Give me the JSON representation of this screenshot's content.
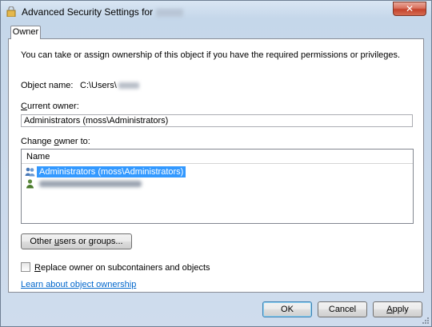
{
  "window": {
    "title": "Advanced Security Settings for",
    "close_glyph": "✕"
  },
  "tabs": [
    {
      "label": "Owner"
    }
  ],
  "owner": {
    "description": "You can take or assign ownership of this object if you have the required permissions or privileges.",
    "object_name_label": "Object name:",
    "object_name_value": "C:\\Users\\",
    "current_owner_label": "Current owner:",
    "current_owner_value": "Administrators (moss\\Administrators)",
    "change_owner_label": "Change owner to:",
    "list": {
      "column_name": "Name",
      "rows": [
        {
          "label": "Administrators (moss\\Administrators)",
          "icon": "group-icon",
          "selected": true
        },
        {
          "label": "",
          "icon": "user-icon",
          "selected": false
        }
      ]
    },
    "other_users_button": "Other users or groups...",
    "replace_owner_label": "Replace owner on subcontainers and objects",
    "replace_owner_checked": false,
    "learn_link": "Learn about object ownership"
  },
  "footer": {
    "ok": "OK",
    "cancel": "Cancel",
    "apply": "Apply"
  },
  "colors": {
    "selection": "#3399ff",
    "link": "#0066cc",
    "close_button": "#c4432c"
  }
}
